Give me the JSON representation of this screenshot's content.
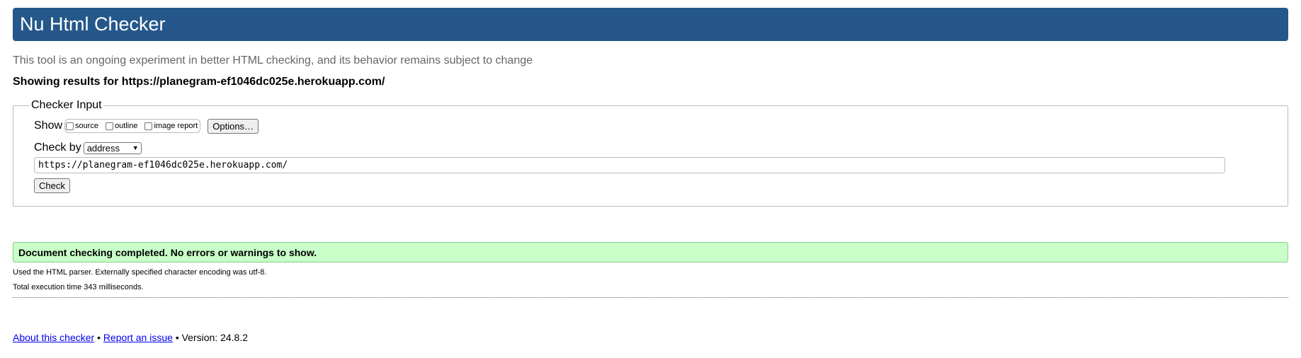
{
  "header": {
    "title": "Nu Html Checker"
  },
  "tagline": "This tool is an ongoing experiment in better HTML checking, and its behavior remains subject to change",
  "results_for": "Showing results for https://planegram-ef1046dc025e.herokuapp.com/",
  "checker_input": {
    "legend": "Checker Input",
    "show_label": "Show",
    "show_options": [
      {
        "label": "source",
        "checked": false
      },
      {
        "label": "outline",
        "checked": false
      },
      {
        "label": "image report",
        "checked": false
      }
    ],
    "options_button": "Options…",
    "check_by_label": "Check by",
    "check_by_selected": "address",
    "url_value": "https://planegram-ef1046dc025e.herokuapp.com/",
    "check_button": "Check"
  },
  "status": {
    "message": "Document checking completed. No errors or warnings to show.",
    "bg_color": "#ccffcc"
  },
  "details": {
    "parser_line": "Used the HTML parser. Externally specified character encoding was utf-8.",
    "time_line": "Total execution time 343 milliseconds."
  },
  "footer": {
    "about_link": "About this checker",
    "sep1": "•",
    "report_link": "Report an issue",
    "sep2": "•",
    "version": "Version: 24.8.2"
  },
  "colors": {
    "header_bg": "#25578a",
    "link": "#0000ee"
  }
}
